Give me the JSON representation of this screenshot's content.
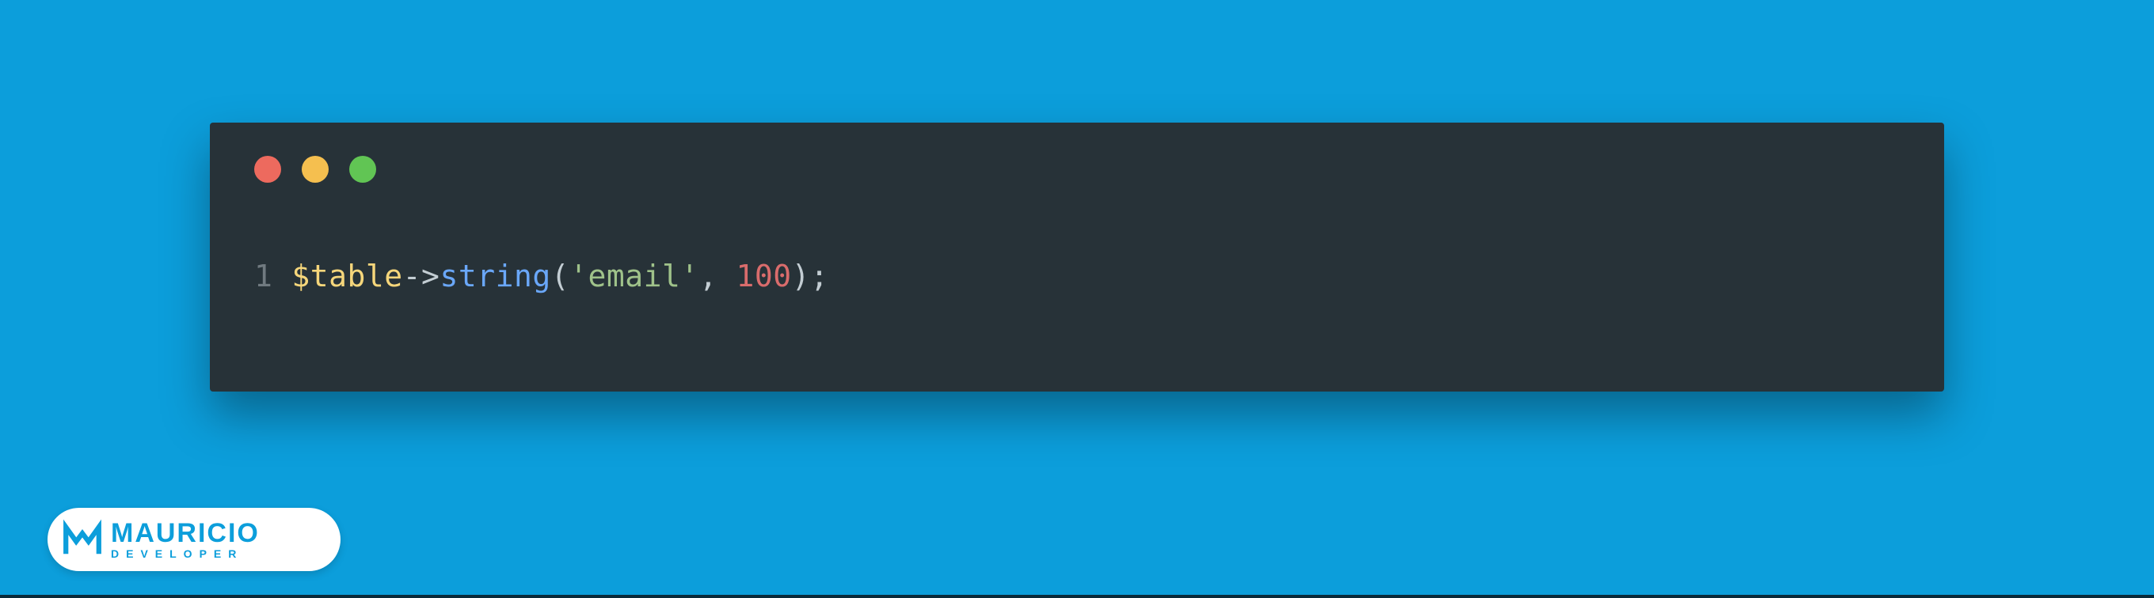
{
  "code": {
    "lineNumber": "1",
    "tokens": {
      "var": "$table",
      "arrow": "->",
      "fn": "string",
      "openParen": "(",
      "str": "'email'",
      "comma": ", ",
      "num": "100",
      "closeParen": ")",
      "semi": ";"
    }
  },
  "badge": {
    "title": "MAURICIO",
    "subtitle": "DEVELOPER"
  }
}
